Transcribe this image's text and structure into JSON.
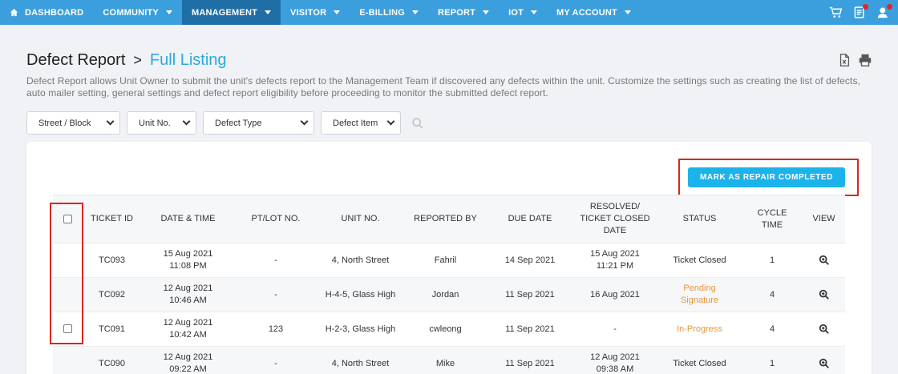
{
  "nav": {
    "items": [
      {
        "label": "DASHBOARD",
        "has_home_icon": true
      },
      {
        "label": "COMMUNITY"
      },
      {
        "label": "MANAGEMENT",
        "active": true
      },
      {
        "label": "VISITOR"
      },
      {
        "label": "E-BILLING"
      },
      {
        "label": "REPORT"
      },
      {
        "label": "IOT"
      },
      {
        "label": "MY ACCOUNT"
      }
    ],
    "icons": [
      "cart-icon",
      "document-icon",
      "user-chat-icon"
    ]
  },
  "header": {
    "title": "Defect Report",
    "breadcrumb_sep": ">",
    "subtitle": "Full Listing",
    "description": "Defect Report allows Unit Owner to submit the unit's defects report to the Management Team if discovered any defects within the unit. Customize the settings such as creating the list of defects, auto mailer setting, general settings and defect report eligibility before proceeding to monitor the submitted defect report."
  },
  "filters": {
    "street_block": "Street / Block",
    "unit_no": "Unit No.",
    "defect_type": "Defect Type",
    "defect_item": "Defect Item"
  },
  "actions": {
    "mark_repair": "MARK AS REPAIR COMPLETED"
  },
  "table": {
    "headers": {
      "ticket_id": "TICKET ID",
      "datetime": "DATE & TIME",
      "pt_lot": "PT/LOT NO.",
      "unit_no": "UNIT NO.",
      "reported_by": "REPORTED BY",
      "due_date": "DUE DATE",
      "resolved_1": "RESOLVED/",
      "resolved_2": "TICKET CLOSED",
      "resolved_3": "DATE",
      "status": "STATUS",
      "cycle_1": "CYCLE",
      "cycle_2": "TIME",
      "view": "VIEW"
    },
    "rows": [
      {
        "checkbox": false,
        "ticket_id": "TC093",
        "date": "15 Aug 2021",
        "time": "11:08 PM",
        "pt_lot": "-",
        "unit": "4, North Street",
        "reported_by": "Fahril",
        "due": "14 Sep 2021",
        "resolved_date": "15 Aug 2021",
        "resolved_time": "11:21 PM",
        "status": "Ticket Closed",
        "status_2": "",
        "status_class": "closed",
        "cycle": "1"
      },
      {
        "checkbox": false,
        "ticket_id": "TC092",
        "date": "12 Aug 2021",
        "time": "10:46 AM",
        "pt_lot": "-",
        "unit": "H-4-5, Glass High",
        "reported_by": "Jordan",
        "due": "11 Sep 2021",
        "resolved_date": "16 Aug 2021",
        "resolved_time": "",
        "status": "Pending",
        "status_2": "Signature",
        "status_class": "pending",
        "cycle": "4"
      },
      {
        "checkbox": true,
        "ticket_id": "TC091",
        "date": "12 Aug 2021",
        "time": "10:42 AM",
        "pt_lot": "123",
        "unit": "H-2-3, Glass High",
        "reported_by": "cwleong",
        "due": "11 Sep 2021",
        "resolved_date": "-",
        "resolved_time": "",
        "status": "In-Progress",
        "status_2": "",
        "status_class": "progress",
        "cycle": "4"
      },
      {
        "checkbox": false,
        "ticket_id": "TC090",
        "date": "12 Aug 2021",
        "time": "09:22 AM",
        "pt_lot": "-",
        "unit": "4, North Street",
        "reported_by": "Mike",
        "due": "11 Sep 2021",
        "resolved_date": "12 Aug 2021",
        "resolved_time": "09:38 AM",
        "status": "Ticket Closed",
        "status_2": "",
        "status_class": "closed",
        "cycle": "1"
      }
    ]
  },
  "colors": {
    "nav_bg": "#3b9fdd",
    "nav_active": "#1f6fa6",
    "accent": "#2aa9df",
    "button": "#1cb3ea",
    "highlight": "#d9261c",
    "status_orange": "#e5973d"
  }
}
